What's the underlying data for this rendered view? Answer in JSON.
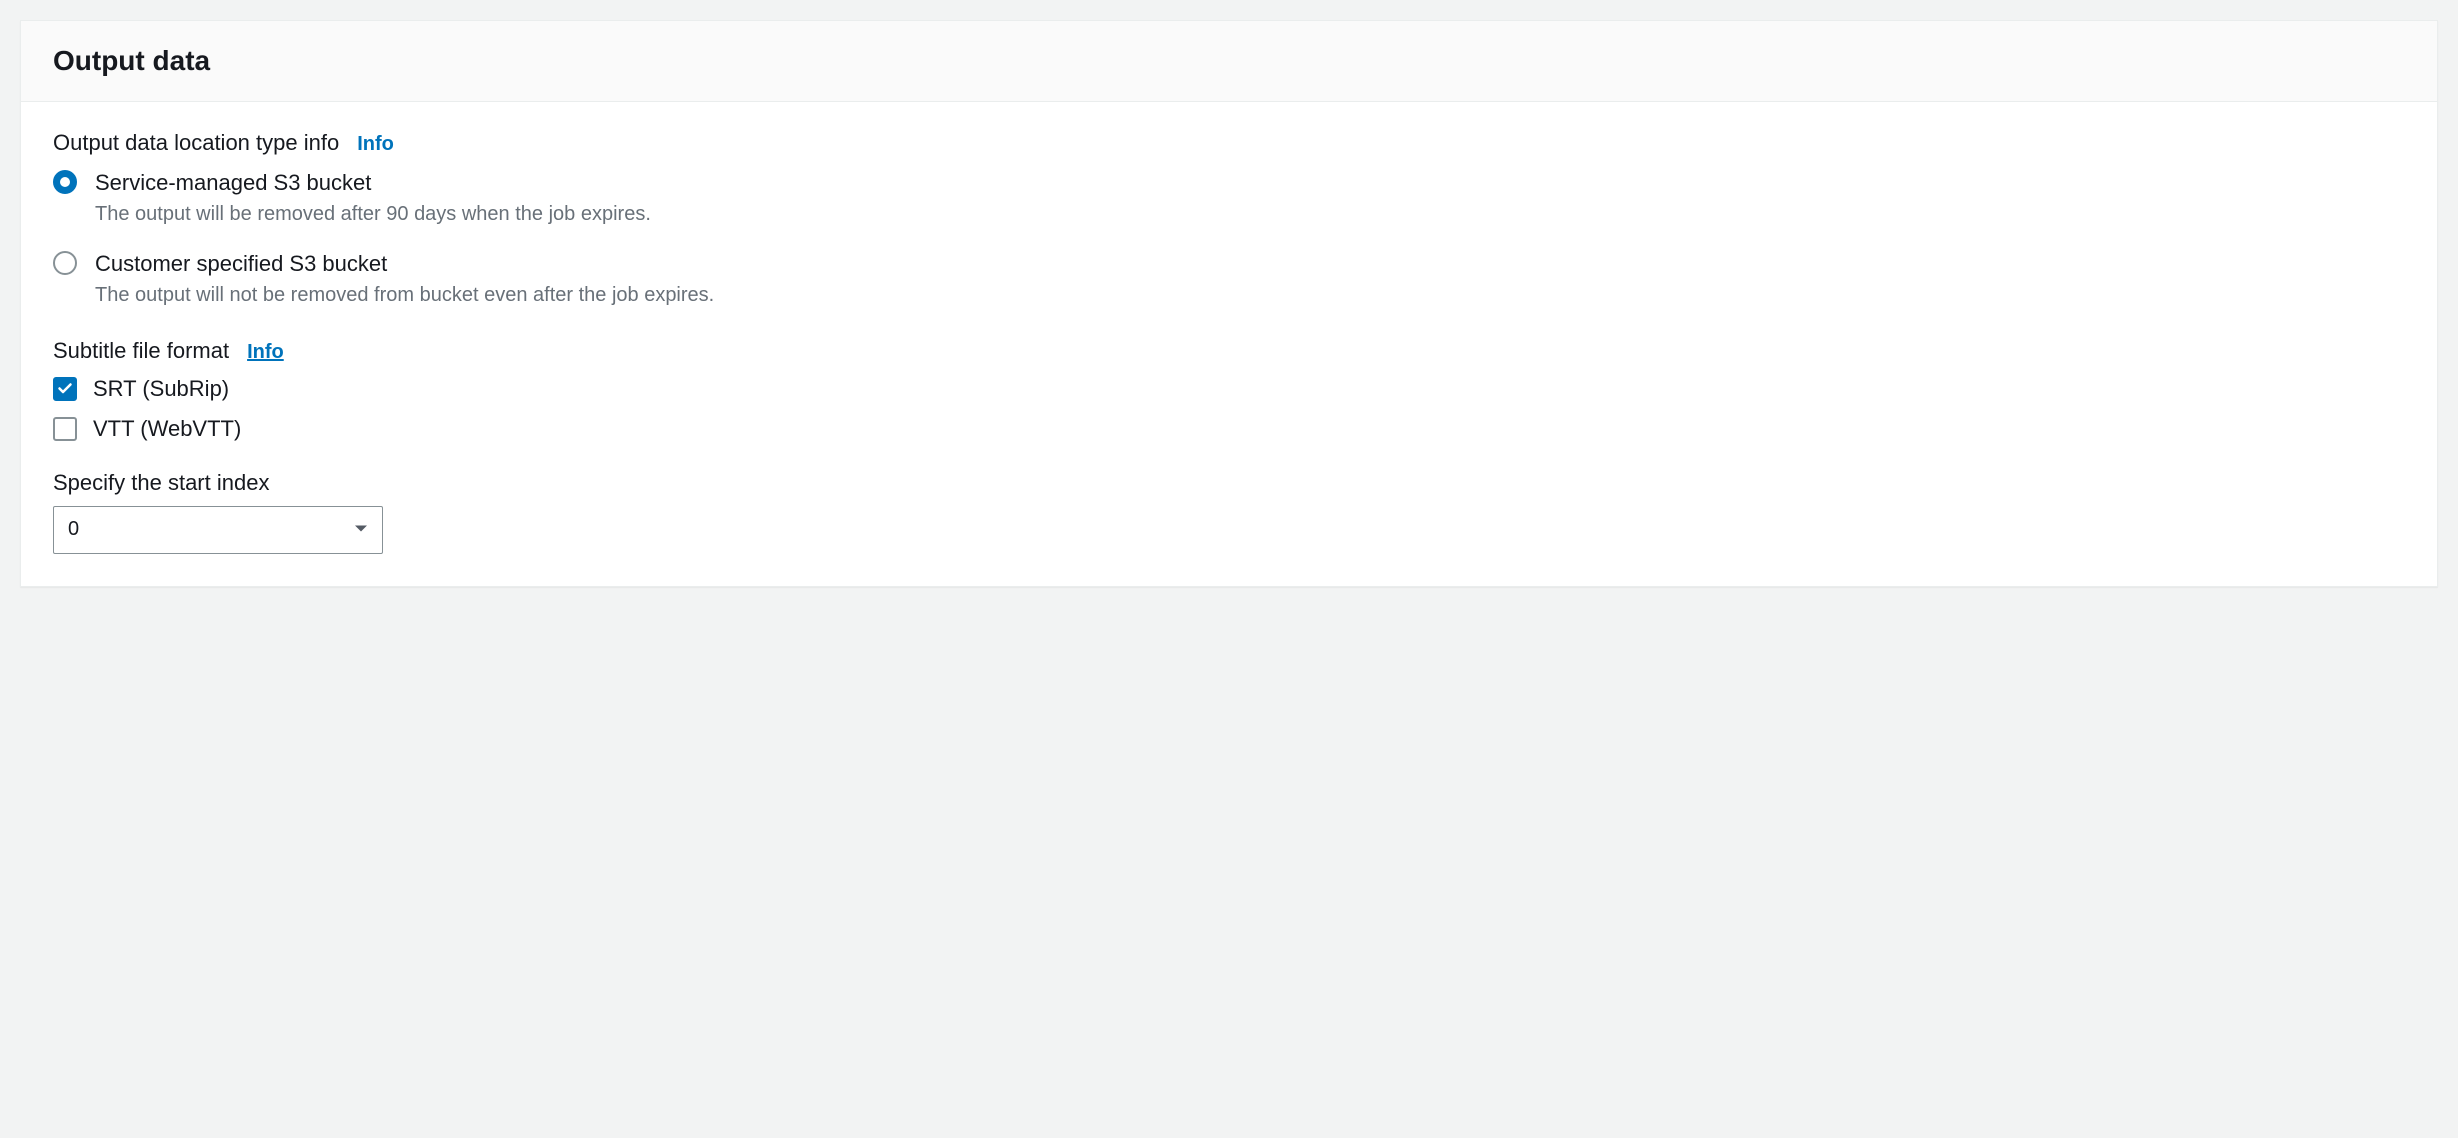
{
  "panel": {
    "title": "Output data"
  },
  "location_type": {
    "label": "Output data location type info",
    "info_label": "Info",
    "options": [
      {
        "title": "Service-managed S3 bucket",
        "desc": "The output will be removed after 90 days when the job expires.",
        "selected": true
      },
      {
        "title": "Customer specified S3 bucket",
        "desc": "The output will not be removed from bucket even after the job expires.",
        "selected": false
      }
    ]
  },
  "subtitle_format": {
    "label": "Subtitle file format",
    "info_label": "Info",
    "options": [
      {
        "label": "SRT (SubRip)",
        "checked": true
      },
      {
        "label": "VTT (WebVTT)",
        "checked": false
      }
    ]
  },
  "start_index": {
    "label": "Specify the start index",
    "value": "0"
  }
}
